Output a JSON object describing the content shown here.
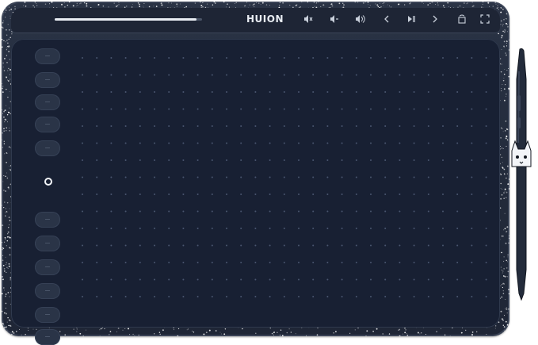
{
  "device": {
    "brand_logo": "HUION",
    "body_color": "#232b3b",
    "active_area_color": "#182033",
    "speckle_color": "#ffffff"
  },
  "top_bar": {
    "progress": 0.96,
    "icons": [
      "mute-icon",
      "volume-down-icon",
      "volume-up-icon",
      "previous-icon",
      "play-pause-icon",
      "next-icon",
      "rotate-icon",
      "fullscreen-icon"
    ]
  },
  "side_keys": {
    "count": 12,
    "marked_index": 5
  },
  "stylus": {
    "emblem": "cat-emblem-icon"
  }
}
